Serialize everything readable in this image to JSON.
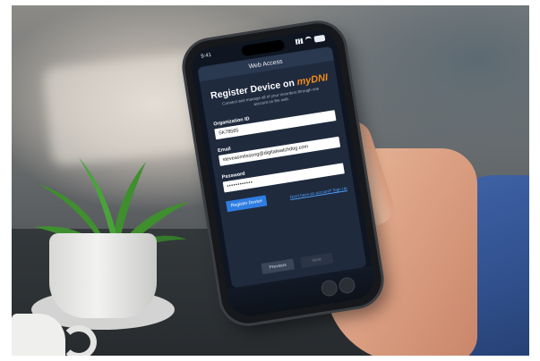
{
  "status_bar": {
    "time": "9:41"
  },
  "card": {
    "header_title": "Web Access",
    "title_prefix": "Register Device on",
    "brand_logo": "myDNI",
    "subtitle": "Connect and manage all of your recorders through one account on the web.",
    "fields": [
      {
        "label": "Organization ID",
        "value": "SK78565"
      },
      {
        "label": "Email",
        "value": "steveasmitssong@digitalwatchdog.com"
      },
      {
        "label": "Password",
        "value": "••••••••••••"
      }
    ],
    "register_button": "Register Device",
    "signup_link": "Don't have an account? Sign Up",
    "previous_button": "Previous",
    "next_button": "Next"
  },
  "icons": {
    "signal": "signal-icon",
    "wifi": "wifi-icon",
    "battery": "battery-icon"
  },
  "colors": {
    "accent_button": "#2f7de1",
    "brand_orange": "#f08a1c",
    "link_blue": "#4da3ff",
    "card_background": "#1f2a3d"
  }
}
